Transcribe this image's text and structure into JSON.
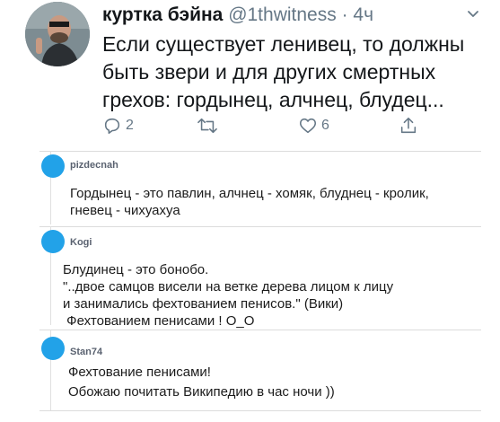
{
  "tweet": {
    "display_name": "куртка бэйна",
    "handle": "@1thwitness",
    "separator": "·",
    "time": "4ч",
    "text": "Если существует ленивец, то должны быть звери и для других смертных грехов: гордынец, алчнец, блудец...",
    "reply_count": "2",
    "like_count": "6",
    "icons": [
      "reply-icon",
      "retweet-icon",
      "like-icon",
      "share-icon",
      "caret-down-icon"
    ],
    "icon_color": "#657786"
  },
  "comments": [
    {
      "user": "pizdecnah",
      "lines": [
        "Гордынец - это павлин, алчнец - хомяк, блуднец - кролик,",
        "гневец - чихуахуа"
      ]
    },
    {
      "user": "Kogi",
      "lines": [
        "Блудинец - это бонобо.",
        "\"..двое самцов висели на ветке дерева лицом к лицу",
        "и занимались фехтованием пенисов.\" (Вики)",
        " Фехтованием пенисами ! О_О"
      ]
    },
    {
      "user": "Stan74",
      "lines": [
        "Фехтование пенисами!",
        "Обожаю почитать Википедию в час ночи ))"
      ]
    }
  ],
  "colors": {
    "avatar_dot": "#22a2e8",
    "text": "#14171a",
    "muted": "#657786"
  }
}
